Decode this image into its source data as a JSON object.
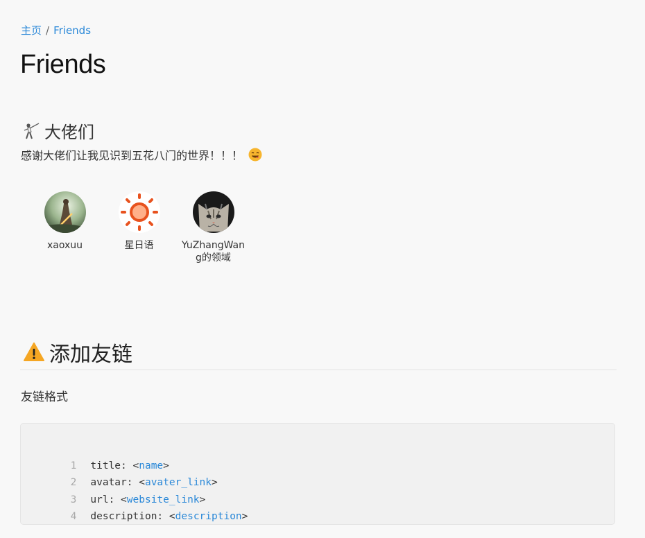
{
  "breadcrumb": {
    "home": "主页",
    "separator": "/",
    "current": "Friends"
  },
  "page_title": "Friends",
  "section": {
    "icon": "fencer-icon",
    "title": "大佬们",
    "intro": "感谢大佬们让我见识到五花八门的世界！！！",
    "intro_icon": "yum-face-icon"
  },
  "friends": [
    {
      "name": "xaoxuu",
      "avatar": "warrior-art-avatar"
    },
    {
      "name": "星日语",
      "avatar": "orange-sun-avatar"
    },
    {
      "name": "YuZhangWang的领域",
      "avatar": "tabby-cat-avatar"
    }
  ],
  "add_link": {
    "icon": "warning-icon",
    "title": "添加友链",
    "format_label": "友链格式"
  },
  "code": {
    "lines": [
      {
        "num": "1",
        "key": "title: ",
        "placeholder": "name"
      },
      {
        "num": "2",
        "key": "avatar: ",
        "placeholder": "avater_link"
      },
      {
        "num": "3",
        "key": "url: ",
        "placeholder": "website_link"
      },
      {
        "num": "4",
        "key": "description: ",
        "placeholder": "description"
      }
    ]
  },
  "colors": {
    "link": "#2a88d8",
    "background": "#f8f8f8",
    "code_background": "#f1f1f1"
  }
}
